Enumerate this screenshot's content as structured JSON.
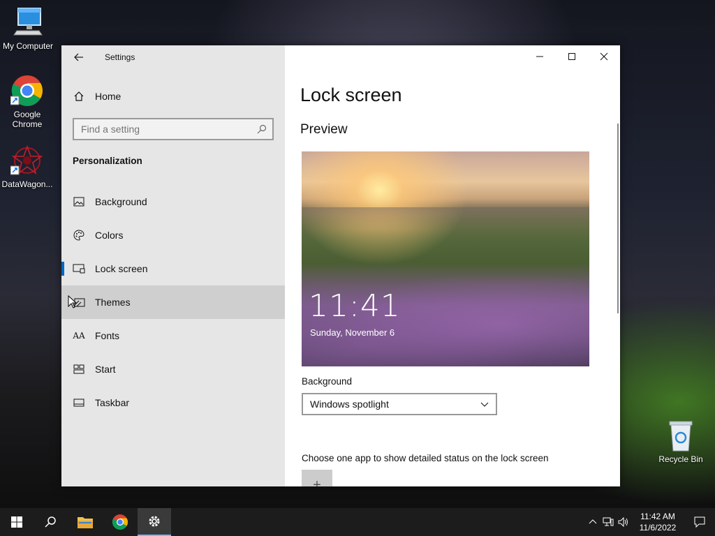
{
  "desktop": {
    "icons": [
      {
        "label": "My Computer"
      },
      {
        "label": "Google\nChrome"
      },
      {
        "label": "DataWagon..."
      },
      {
        "label": "Recycle Bin"
      }
    ]
  },
  "window": {
    "app_title": "Settings",
    "sidebar": {
      "home_label": "Home",
      "search_placeholder": "Find a setting",
      "section_title": "Personalization",
      "items": [
        {
          "label": "Background",
          "icon": "picture-icon"
        },
        {
          "label": "Colors",
          "icon": "palette-icon"
        },
        {
          "label": "Lock screen",
          "icon": "lock-screen-icon",
          "selected": true
        },
        {
          "label": "Themes",
          "icon": "themes-icon",
          "hover": true
        },
        {
          "label": "Fonts",
          "icon": "fonts-icon"
        },
        {
          "label": "Start",
          "icon": "start-icon"
        },
        {
          "label": "Taskbar",
          "icon": "taskbar-icon"
        }
      ]
    },
    "content": {
      "page_title": "Lock screen",
      "preview_title": "Preview",
      "preview_time": "11:41",
      "preview_date": "Sunday, November 6",
      "background_label": "Background",
      "background_value": "Windows spotlight",
      "status_label": "Choose one app to show detailed status on the lock screen",
      "add_symbol": "+"
    }
  },
  "taskbar": {
    "clock_time": "11:42 AM",
    "clock_date": "11/6/2022",
    "accent": "#78b9ff"
  }
}
